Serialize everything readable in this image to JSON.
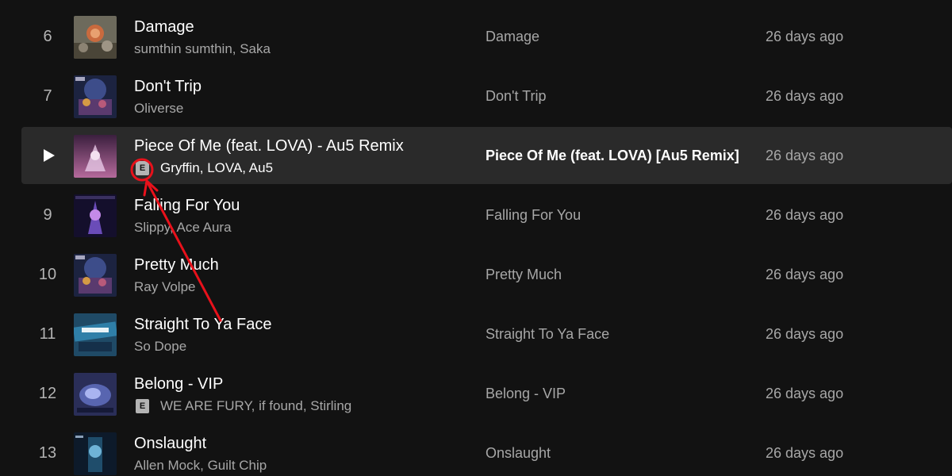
{
  "tracks": [
    {
      "number": "6",
      "title": "Damage",
      "artists": "sumthin sumthin, Saka",
      "explicit": false,
      "album": "Damage",
      "added": "26 days ago",
      "active": false
    },
    {
      "number": "7",
      "title": "Don't Trip",
      "artists": "Oliverse",
      "explicit": false,
      "album": "Don't Trip",
      "added": "26 days ago",
      "active": false
    },
    {
      "number": "",
      "title": "Piece Of Me (feat. LOVA) - Au5 Remix",
      "artists": "Gryffin, LOVA, Au5",
      "explicit": true,
      "album": "Piece Of Me (feat. LOVA) [Au5 Remix]",
      "added": "26 days ago",
      "active": true
    },
    {
      "number": "9",
      "title": "Falling For You",
      "artists": "Slippy, Ace Aura",
      "explicit": false,
      "album": "Falling For You",
      "added": "26 days ago",
      "active": false
    },
    {
      "number": "10",
      "title": "Pretty Much",
      "artists": "Ray Volpe",
      "explicit": false,
      "album": "Pretty Much",
      "added": "26 days ago",
      "active": false
    },
    {
      "number": "11",
      "title": "Straight To Ya Face",
      "artists": "So Dope",
      "explicit": false,
      "album": "Straight To Ya Face",
      "added": "26 days ago",
      "active": false
    },
    {
      "number": "12",
      "title": "Belong - VIP",
      "artists": "WE ARE FURY, if found, Stirling",
      "explicit": true,
      "album": "Belong - VIP",
      "added": "26 days ago",
      "active": false
    },
    {
      "number": "13",
      "title": "Onslaught",
      "artists": "Allen Mock, Guilt Chip",
      "explicit": false,
      "album": "Onslaught",
      "added": "26 days ago",
      "active": false
    }
  ],
  "explicit_label": "E",
  "play_icon": "play-icon",
  "annotation_color": "#e8111b",
  "colors": {
    "background": "#121212",
    "active_row": "#2a2a2a",
    "primary_text": "#ffffff",
    "secondary_text": "#a7a7a7"
  }
}
